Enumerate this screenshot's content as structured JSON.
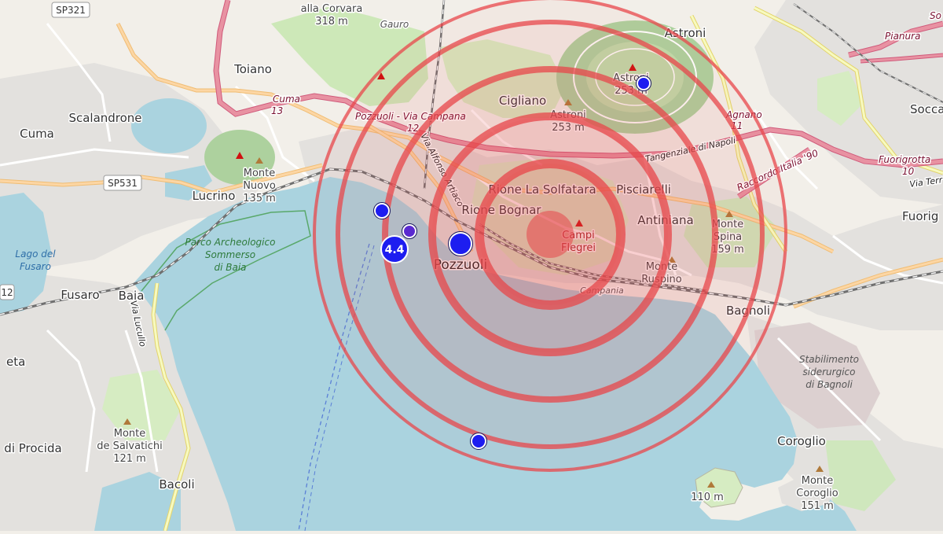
{
  "places": {
    "corvara_name": "alla Corvara",
    "corvara_elev": "318 m",
    "gauro": "Gauro",
    "astroni_top": "Astroni",
    "astroni_crater_name": "Astroni",
    "astroni_crater_elev": "253 m",
    "astroni_mid_name": "Astroni",
    "astroni_mid_elev": "253 m",
    "toiano": "Toiano",
    "cigliano": "Cigliano",
    "scalandrone": "Scalandrone",
    "cuma_town": "Cuma",
    "monte_nuovo_name1": "Monte",
    "monte_nuovo_name2": "Nuovo",
    "monte_nuovo_elev": "135 m",
    "lucrino": "Lucrino",
    "rione_solfatara": "Rione La Solfatara",
    "rione_bognar": "Rione Bognar",
    "pisciarelli": "Pisciarelli",
    "antiniana": "Antiniana",
    "campi_flegrei_1": "Campi",
    "campi_flegrei_2": "Flegrei",
    "pozzuoli": "Pozzuoli",
    "monte_spina_1": "Monte",
    "monte_spina_2": "Spina",
    "monte_spina_elev": "159 m",
    "monte_ruspino_1": "Monte",
    "monte_ruspino_2": "Ruspino",
    "campania": "Campania",
    "bagnoli": "Bagnoli",
    "fusaro": "Fusaro",
    "baia": "Baia",
    "eta": "eta",
    "di_procida": "di Procida",
    "monte_salvatichi_1": "Monte",
    "monte_salvatichi_2": "de Salvatichi",
    "monte_salvatichi_elev": "121 m",
    "bacoli": "Bacoli",
    "coroglio": "Coroglio",
    "monte_coroglio_1": "Monte",
    "monte_coroglio_2": "Coroglio",
    "monte_coroglio_elev": "151 m",
    "nisida_elev": "110 m",
    "socca": "Socca",
    "fuorig": "Fuorig",
    "pianura": "Pianura",
    "so": "So"
  },
  "roads": {
    "sp321": "SP321",
    "sp531": "SP531",
    "shield_12": "12",
    "cuma_13_a": "Cuma",
    "cuma_13_b": "13",
    "pozzuoli_via_campana_a": "Pozzuoli - Via Campana",
    "pozzuoli_via_campana_b": "12",
    "via_alfonso_artiaco": "Via Alfonso Artiaco",
    "tangenziale": "Tangenziale di Napoli",
    "agnano_a": "Agnano",
    "agnano_b": "11",
    "raccordo": "Raccordo Italia '90",
    "fuorigrotta_a": "Fuorigrotta",
    "fuorigrotta_b": "10",
    "via_terr": "Via Terr",
    "via_lucullo": "Via Lucullo"
  },
  "areas": {
    "lago_fusaro_1": "Lago del",
    "lago_fusaro_2": "Fusaro",
    "parco_1": "Parco Archeologico",
    "parco_2": "Sommerso",
    "parco_3": "di Baia",
    "stabilimento_1": "Stabilimento",
    "stabilimento_2": "siderurgico",
    "stabilimento_3": "di Bagnoli"
  },
  "quakes": {
    "main_magnitude": "4.4",
    "epicenter_color": "#e8474b",
    "marker_color": "#1d1df0"
  },
  "colors": {
    "sea": "#aad3df",
    "land": "#f2efe9",
    "park": "#c8e6b0",
    "forest": "#add19e",
    "urban": "#e0dfdf",
    "motorway": "#e892a2",
    "trunk": "#f9b29c",
    "primary": "#fcd6a4"
  }
}
